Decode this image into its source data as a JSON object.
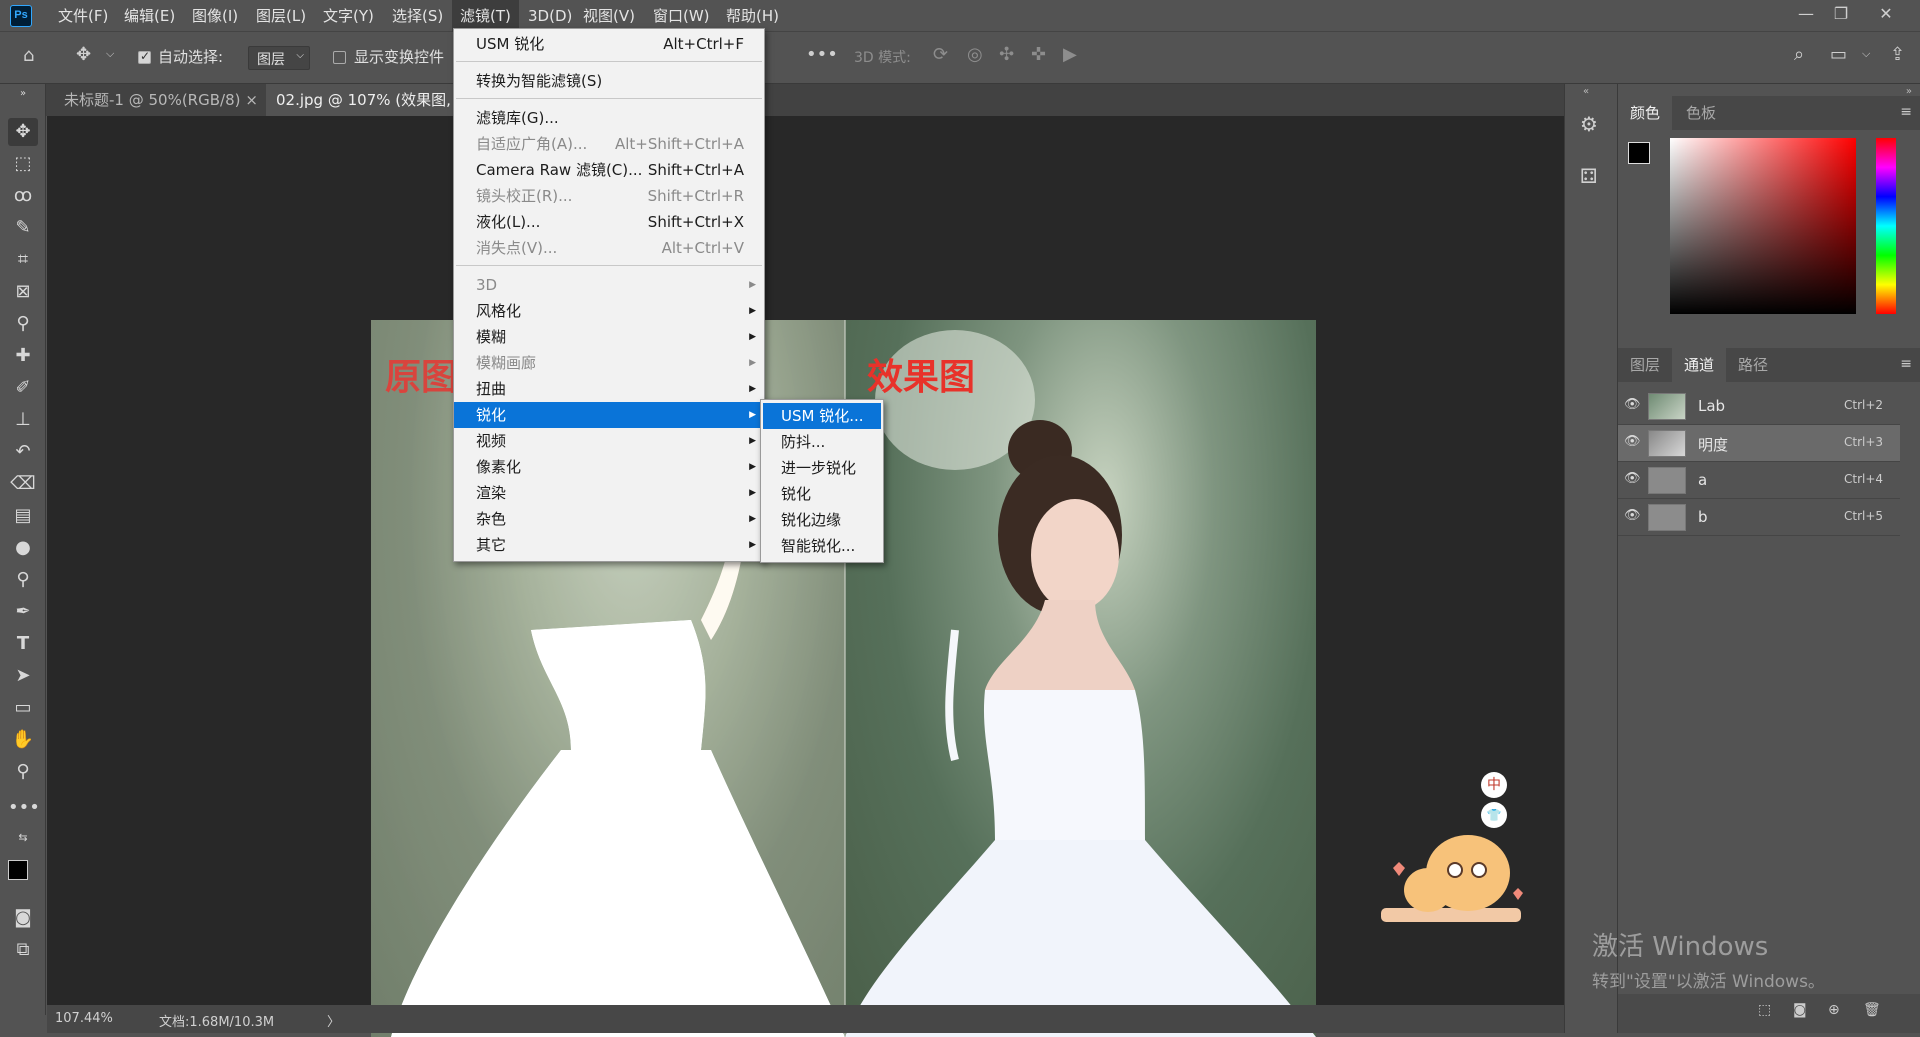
{
  "menubar": {
    "logo": "Ps",
    "items": [
      "文件(F)",
      "编辑(E)",
      "图像(I)",
      "图层(L)",
      "文字(Y)",
      "选择(S)",
      "滤镜(T)",
      "3D(D)",
      "视图(V)",
      "窗口(W)",
      "帮助(H)"
    ],
    "active_index": 6
  },
  "options_bar": {
    "auto_select_label": "自动选择:",
    "auto_select_value": "图层",
    "show_transform_label": "显示变换控件",
    "mode_3d_label": "3D 模式:"
  },
  "tabs": [
    {
      "label": "未标题-1 @ 50%(RGB/8)",
      "close": "×"
    },
    {
      "label": "02.jpg @ 107% (效果图, R"
    }
  ],
  "photo": {
    "left_label": "原图",
    "right_label": "效果图"
  },
  "filter_menu": {
    "items": [
      {
        "label": "USM 锐化",
        "shortcut": "Alt+Ctrl+F",
        "disabled": false
      },
      {
        "label": "转换为智能滤镜(S)",
        "shortcut": "",
        "disabled": false
      },
      {
        "label": "滤镜库(G)...",
        "shortcut": "",
        "disabled": false
      },
      {
        "label": "自适应广角(A)...",
        "shortcut": "Alt+Shift+Ctrl+A",
        "disabled": true
      },
      {
        "label": "Camera Raw 滤镜(C)...",
        "shortcut": "Shift+Ctrl+A",
        "disabled": false
      },
      {
        "label": "镜头校正(R)...",
        "shortcut": "Shift+Ctrl+R",
        "disabled": true
      },
      {
        "label": "液化(L)...",
        "shortcut": "Shift+Ctrl+X",
        "disabled": false
      },
      {
        "label": "消失点(V)...",
        "shortcut": "Alt+Ctrl+V",
        "disabled": true
      },
      {
        "label": "3D",
        "shortcut": "",
        "disabled": true
      },
      {
        "label": "风格化",
        "shortcut": "",
        "disabled": false
      },
      {
        "label": "模糊",
        "shortcut": "",
        "disabled": false
      },
      {
        "label": "模糊画廊",
        "shortcut": "",
        "disabled": true
      },
      {
        "label": "扭曲",
        "shortcut": "",
        "disabled": false
      },
      {
        "label": "锐化",
        "shortcut": "",
        "disabled": false
      },
      {
        "label": "视频",
        "shortcut": "",
        "disabled": false
      },
      {
        "label": "像素化",
        "shortcut": "",
        "disabled": false
      },
      {
        "label": "渲染",
        "shortcut": "",
        "disabled": false
      },
      {
        "label": "杂色",
        "shortcut": "",
        "disabled": false
      },
      {
        "label": "其它",
        "shortcut": "",
        "disabled": false
      }
    ],
    "highlighted_index": 13
  },
  "sharpen_submenu": {
    "items": [
      "USM 锐化...",
      "防抖...",
      "进一步锐化",
      "锐化",
      "锐化边缘",
      "智能锐化..."
    ],
    "highlighted_index": 0
  },
  "color_panel": {
    "tabs": [
      "颜色",
      "色板"
    ],
    "active_tab": 0,
    "foreground": "#000000",
    "background": "#ffffff"
  },
  "channels_panel": {
    "tabs": [
      "图层",
      "通道",
      "路径"
    ],
    "active_tab": 1,
    "rows": [
      {
        "name": "Lab",
        "shortcut": "Ctrl+2"
      },
      {
        "name": "明度",
        "shortcut": "Ctrl+3"
      },
      {
        "name": "a",
        "shortcut": "Ctrl+4"
      },
      {
        "name": "b",
        "shortcut": "Ctrl+5"
      }
    ],
    "selected_index": 1
  },
  "status": {
    "zoom": "107.44%",
    "doc": "文档:1.68M/10.3M",
    "arrow": "〉"
  },
  "sticker": {
    "badge_top": "中",
    "badge_bottom": "👕"
  },
  "activation": {
    "title": "激活 Windows",
    "subtitle": "转到\"设置\"以激活 Windows。"
  },
  "colors": {
    "menu_highlight": "#0a74d8",
    "ui_bg": "#535353",
    "canvas_bg": "#282828",
    "label_red": "#e8322a"
  }
}
